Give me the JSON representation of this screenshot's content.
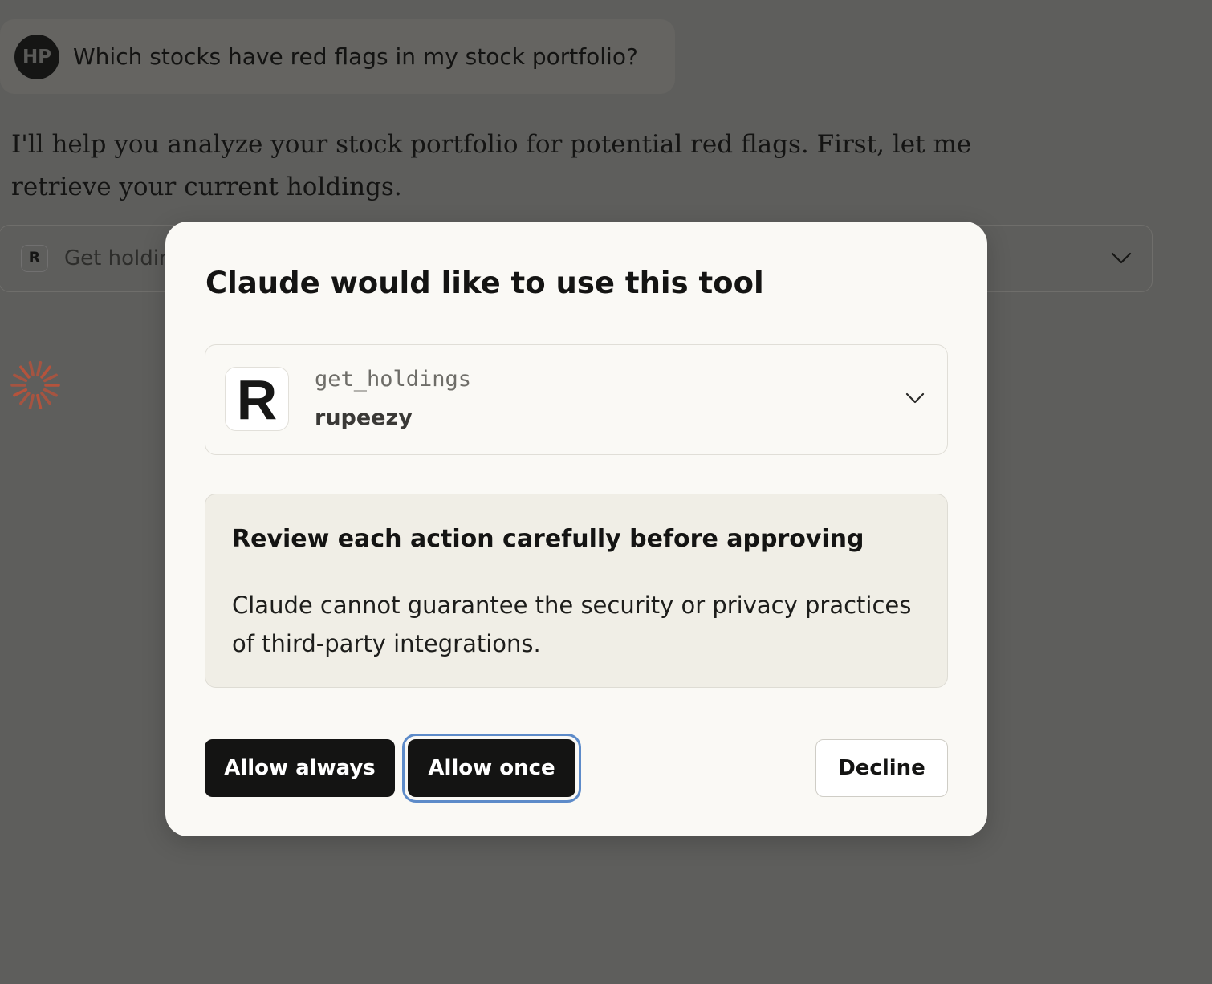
{
  "conversation": {
    "user": {
      "avatar_initials": "HP",
      "message": "Which stocks have red flags in my stock portfolio?"
    },
    "assistant": {
      "message": "I'll help you analyze your stock portfolio for potential red flags. First, let me retrieve your current holdings."
    },
    "tool_call": {
      "badge": "R",
      "label": "Get holdings",
      "icon": "chevron-down-icon"
    },
    "status": {
      "icon": "loading-spinner-icon",
      "color": "#b5533c"
    }
  },
  "modal": {
    "title": "Claude would like to use this tool",
    "tool": {
      "icon_letter": "R",
      "function_name": "get_holdings",
      "provider": "rupeezy",
      "expand_icon": "chevron-down-icon"
    },
    "warning": {
      "title": "Review each action carefully before approving",
      "text": "Claude cannot guarantee the security or privacy practices of third-party integrations."
    },
    "buttons": {
      "allow_always": "Allow always",
      "allow_once": "Allow once",
      "decline": "Decline"
    },
    "focus_ring_color": "#5d8bc9"
  }
}
